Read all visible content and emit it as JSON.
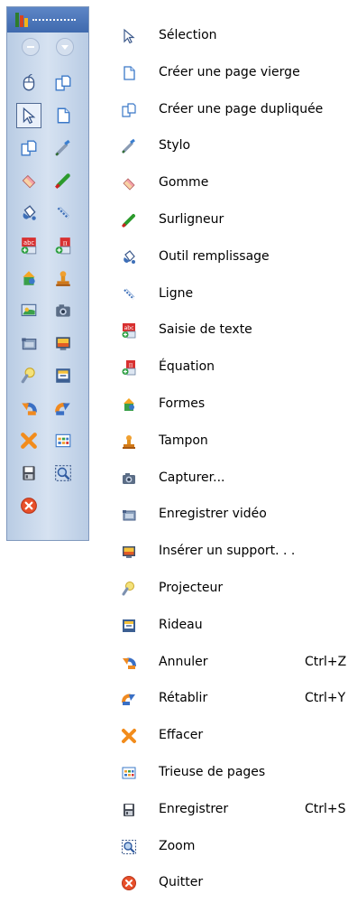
{
  "toolbar": {
    "tools": [
      {
        "name": "mouse-icon",
        "icon": "mouse"
      },
      {
        "name": "duplicate-page-icon",
        "icon": "duplicate"
      },
      {
        "name": "select-arrow-icon",
        "icon": "select",
        "selected": true
      },
      {
        "name": "blank-page-icon",
        "icon": "page"
      },
      {
        "name": "duplicated-page-icon",
        "icon": "duplicate"
      },
      {
        "name": "pen-icon",
        "icon": "pen"
      },
      {
        "name": "eraser-icon",
        "icon": "eraser"
      },
      {
        "name": "highlighter-icon",
        "icon": "highlighter"
      },
      {
        "name": "fill-bucket-icon",
        "icon": "fill"
      },
      {
        "name": "line-icon",
        "icon": "line"
      },
      {
        "name": "text-entry-icon",
        "icon": "text"
      },
      {
        "name": "equation-icon",
        "icon": "equation"
      },
      {
        "name": "shapes-icon",
        "icon": "shapes"
      },
      {
        "name": "stamp-icon",
        "icon": "stamp"
      },
      {
        "name": "screen-capture-icon",
        "icon": "screencap"
      },
      {
        "name": "camera-icon",
        "icon": "camera"
      },
      {
        "name": "video-record-icon",
        "icon": "video"
      },
      {
        "name": "insert-media-icon",
        "icon": "media"
      },
      {
        "name": "spotlight-icon",
        "icon": "spotlight"
      },
      {
        "name": "curtain-icon",
        "icon": "curtain"
      },
      {
        "name": "undo-icon",
        "icon": "undo"
      },
      {
        "name": "redo-icon",
        "icon": "redo"
      },
      {
        "name": "clear-icon",
        "icon": "clear"
      },
      {
        "name": "page-sorter-icon",
        "icon": "sorter"
      },
      {
        "name": "save-icon",
        "icon": "save"
      },
      {
        "name": "zoom-icon",
        "icon": "zoom"
      },
      {
        "name": "quit-icon",
        "icon": "quit"
      }
    ]
  },
  "menu": {
    "items": [
      {
        "label": "Sélection",
        "icon": "select",
        "shortcut": ""
      },
      {
        "label": "Créer une page vierge",
        "icon": "page",
        "shortcut": ""
      },
      {
        "label": "Créer une page dupliquée",
        "icon": "duplicate",
        "shortcut": ""
      },
      {
        "label": "Stylo",
        "icon": "pen",
        "shortcut": ""
      },
      {
        "label": "Gomme",
        "icon": "eraser",
        "shortcut": ""
      },
      {
        "label": "Surligneur",
        "icon": "highlighter",
        "shortcut": ""
      },
      {
        "label": "Outil remplissage",
        "icon": "fill",
        "shortcut": ""
      },
      {
        "label": "Ligne",
        "icon": "line",
        "shortcut": ""
      },
      {
        "label": "Saisie de texte",
        "icon": "text",
        "shortcut": ""
      },
      {
        "label": "Équation",
        "icon": "equation",
        "shortcut": ""
      },
      {
        "label": "Formes",
        "icon": "shapes",
        "shortcut": ""
      },
      {
        "label": "Tampon",
        "icon": "stamp",
        "shortcut": ""
      },
      {
        "label": "Capturer...",
        "icon": "camera",
        "shortcut": ""
      },
      {
        "label": "Enregistrer vidéo",
        "icon": "video",
        "shortcut": ""
      },
      {
        "label": "Insérer un support. . .",
        "icon": "media",
        "shortcut": ""
      },
      {
        "label": "Projecteur",
        "icon": "spotlight",
        "shortcut": ""
      },
      {
        "label": "Rideau",
        "icon": "curtain",
        "shortcut": ""
      },
      {
        "label": "Annuler",
        "icon": "undo",
        "shortcut": "Ctrl+Z"
      },
      {
        "label": "Rétablir",
        "icon": "redo",
        "shortcut": "Ctrl+Y"
      },
      {
        "label": "Effacer",
        "icon": "clear",
        "shortcut": ""
      },
      {
        "label": "Trieuse de pages",
        "icon": "sorter",
        "shortcut": ""
      },
      {
        "label": "Enregistrer",
        "icon": "save",
        "shortcut": "Ctrl+S"
      },
      {
        "label": "Zoom",
        "icon": "zoom",
        "shortcut": ""
      },
      {
        "label": "Quitter",
        "icon": "quit",
        "shortcut": ""
      }
    ]
  }
}
